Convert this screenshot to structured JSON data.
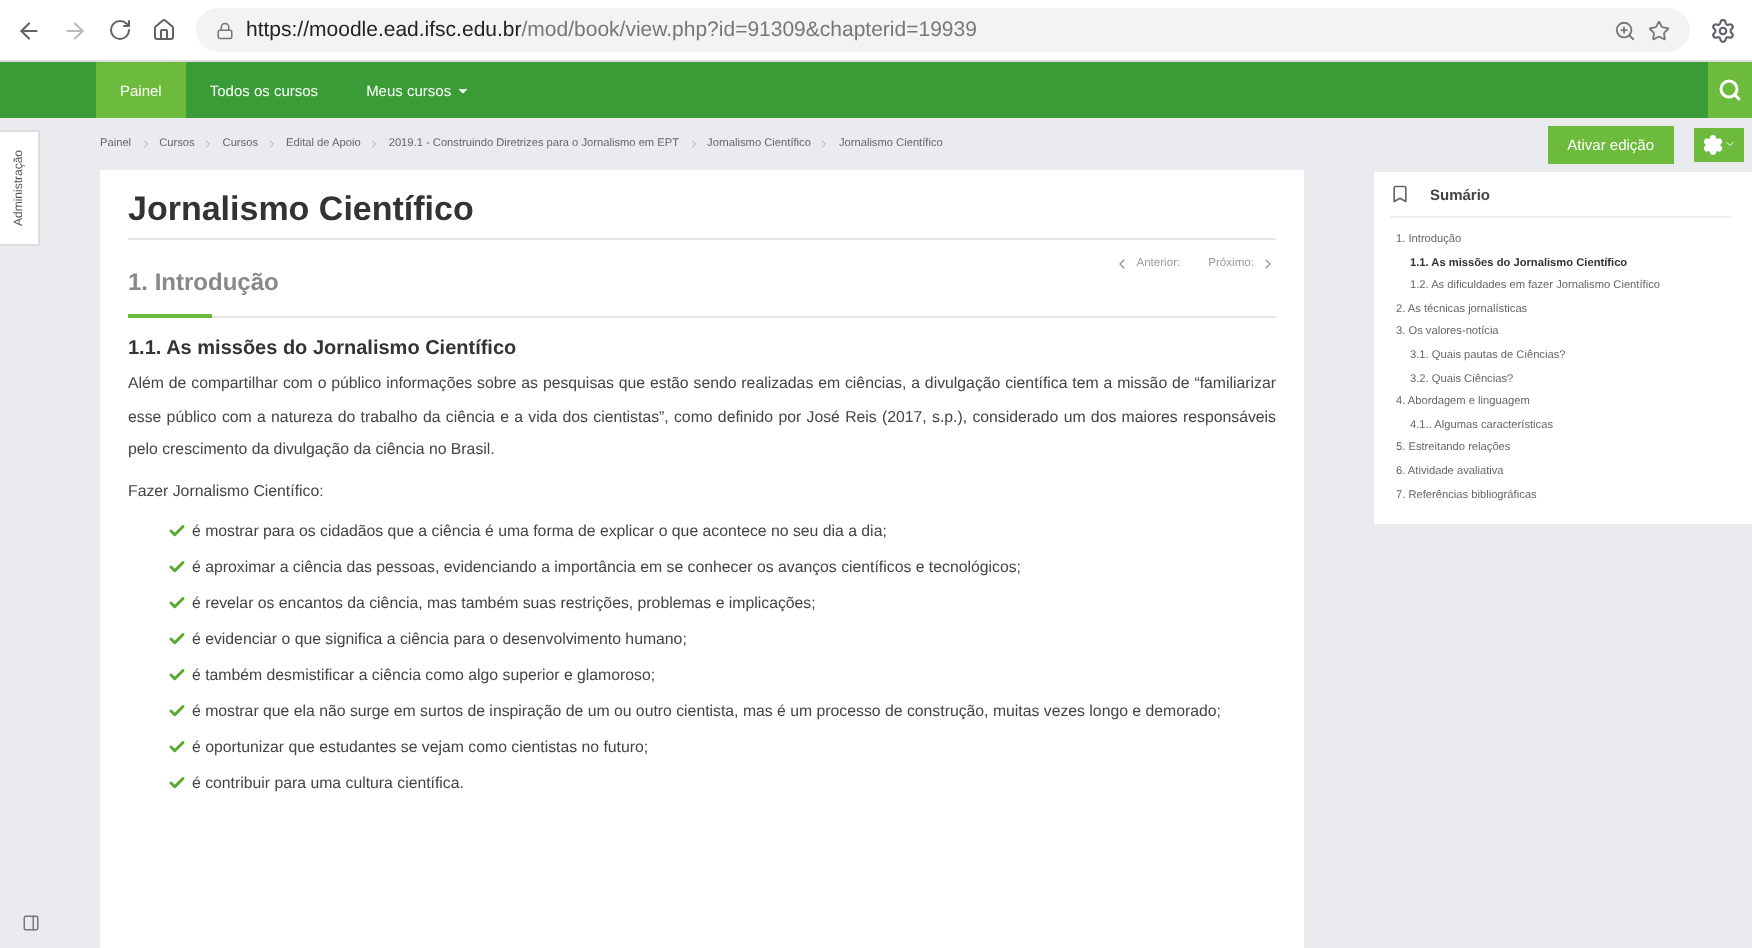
{
  "browser": {
    "url_host": "https://moodle.ead.ifsc.edu.br",
    "url_path": "/mod/book/view.php?id=91309&chapterid=19939"
  },
  "nav": {
    "items": [
      {
        "label": "Painel",
        "selected": true
      },
      {
        "label": "Todos os cursos",
        "selected": false
      },
      {
        "label": "Meus cursos",
        "selected": false,
        "dropdown": true
      }
    ]
  },
  "breadcrumb": [
    "Painel",
    "Cursos",
    "Cursos",
    "Edital de Apoio",
    "2019.1 - Construindo Diretrizes para o Jornalismo em EPT",
    "Jornalismo Científico",
    "Jornalismo Científico"
  ],
  "edit_button": "Ativar edição",
  "side_tab": "Administração",
  "book": {
    "title": "Jornalismo Científico",
    "chapter": "1. Introdução",
    "prev": "Anterior:",
    "next": "Próximo:",
    "section": "1.1. As missões do Jornalismo Científico",
    "paragraph": "Além de compartilhar com o público informações sobre as pesquisas que estão sendo realizadas em ciências, a divulgação científica tem a missão de “familiarizar esse público com a natureza do trabalho da ciência e a vida dos cientistas”, como definido por José Reis (2017, s.p.), considerado um dos maiores responsáveis pelo crescimento da divulgação da ciência no Brasil.",
    "lead": "Fazer Jornalismo Científico:",
    "list": [
      "é mostrar para os cidadãos que a ciência é uma forma de explicar o que acontece no seu dia a dia;",
      "é aproximar a ciência das pessoas, evidenciando a importância em se conhecer os avanços científicos e tecnológicos;",
      "é revelar os encantos da ciência, mas também suas restrições, problemas e implicações;",
      "é evidenciar o que significa a ciência para o desenvolvimento humano;",
      "é também desmistificar a ciência como algo superior e glamoroso;",
      "é mostrar que ela não surge em surtos de inspiração de um ou outro cientista, mas é um processo de construção, muitas vezes longo e demorado;",
      "é oportunizar que estudantes se vejam como cientistas no futuro;",
      "é contribuir para uma cultura científica."
    ]
  },
  "toc": {
    "title": "Sumário",
    "items": [
      {
        "label": "1. Introdução",
        "selected": false,
        "children": [
          {
            "label": "1.1. As missões do Jornalismo Científico",
            "selected": true
          },
          {
            "label": "1.2. As dificuldades em fazer Jornalismo Científico",
            "selected": false
          }
        ]
      },
      {
        "label": "2. As técnicas jornalísticas",
        "selected": false
      },
      {
        "label": "3. Os valores-notícia",
        "selected": false,
        "children": [
          {
            "label": "3.1. Quais pautas de Ciências?",
            "selected": false
          },
          {
            "label": "3.2. Quais Ciências?",
            "selected": false
          }
        ]
      },
      {
        "label": "4. Abordagem e linguagem",
        "selected": false,
        "children": [
          {
            "label": "4.1.. Algumas características",
            "selected": false
          }
        ]
      },
      {
        "label": "5. Estreitando relações",
        "selected": false
      },
      {
        "label": "6. Atividade avaliativa",
        "selected": false
      },
      {
        "label": "7. Referências bibliográficas",
        "selected": false
      }
    ]
  }
}
